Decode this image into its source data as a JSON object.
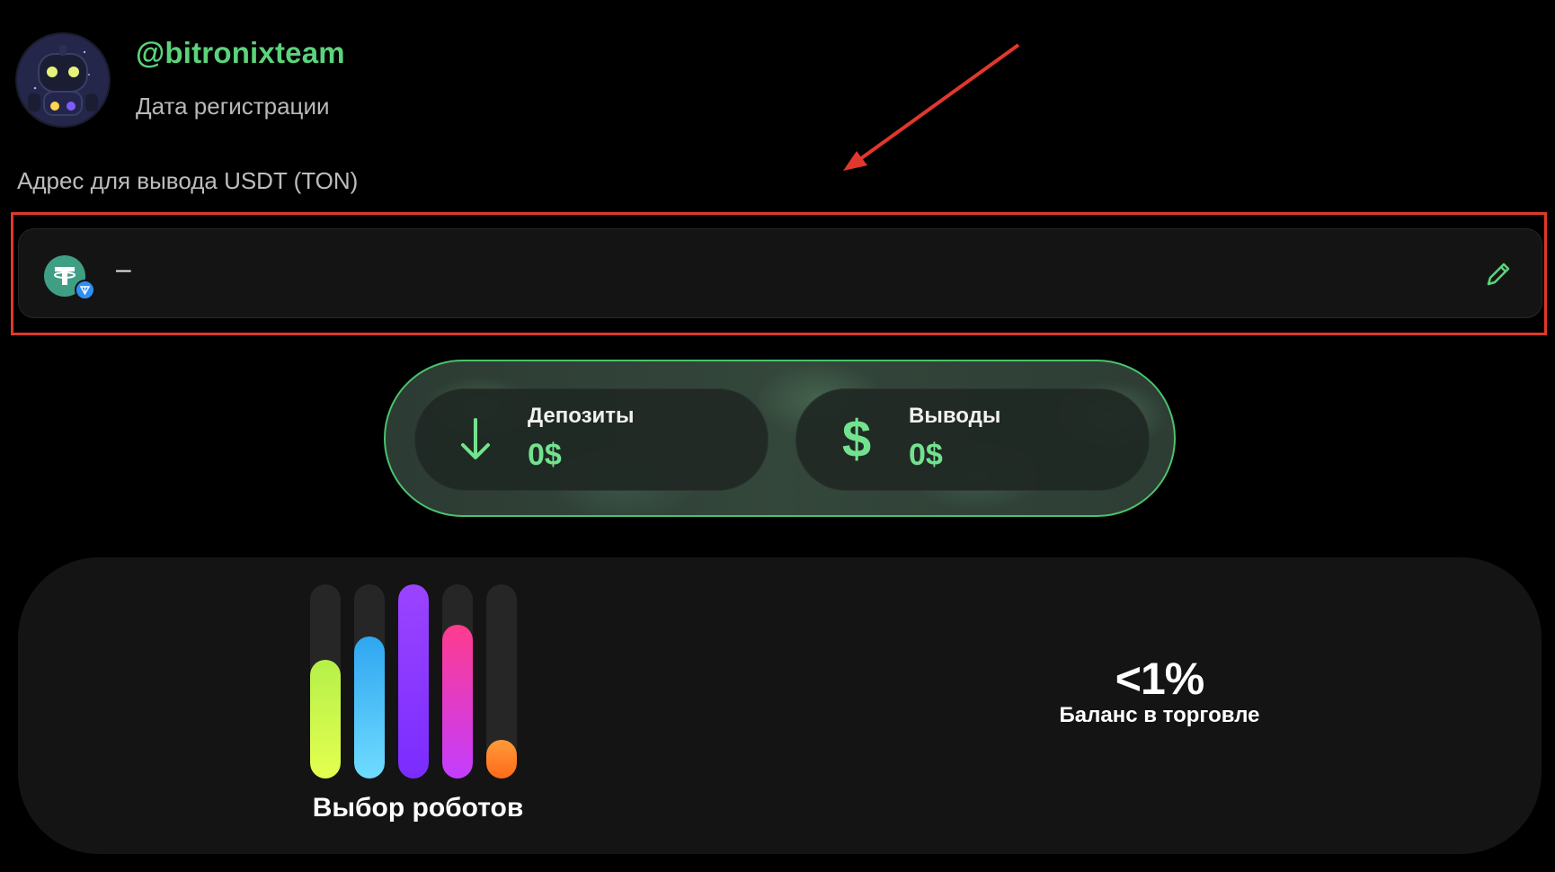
{
  "profile": {
    "username": "@bitronixteam",
    "registration_label": "Дата регистрации"
  },
  "withdraw_address": {
    "label": "Адрес для вывода USDT (TON)",
    "value": "–",
    "currency_icon": "usdt-icon",
    "network_icon": "ton-icon",
    "edit_icon": "pencil-icon"
  },
  "stats": {
    "deposits": {
      "title": "Депозиты",
      "value": "0$",
      "icon": "arrow-down-icon"
    },
    "withdrawals": {
      "title": "Выводы",
      "value": "0$",
      "icon": "dollar-icon"
    }
  },
  "robots": {
    "label": "Выбор роботов",
    "bars": [
      {
        "level": 0.61,
        "color_from": "#e4ff4f",
        "color_to": "#b6f04a"
      },
      {
        "level": 0.73,
        "color_from": "#6fdcff",
        "color_to": "#2fa6f0"
      },
      {
        "level": 1.0,
        "color_from": "#7a2cff",
        "color_to": "#9b44ff"
      },
      {
        "level": 0.79,
        "color_from": "#c33dff",
        "color_to": "#ff3b8e"
      },
      {
        "level": 0.2,
        "color_from": "#ff6a1a",
        "color_to": "#ff9a3b"
      }
    ]
  },
  "balance_in_trade": {
    "value": "<1%",
    "label": "Баланс в торговле"
  },
  "colors": {
    "accent_green": "#5bd37a",
    "highlight_red": "#e0382c"
  }
}
